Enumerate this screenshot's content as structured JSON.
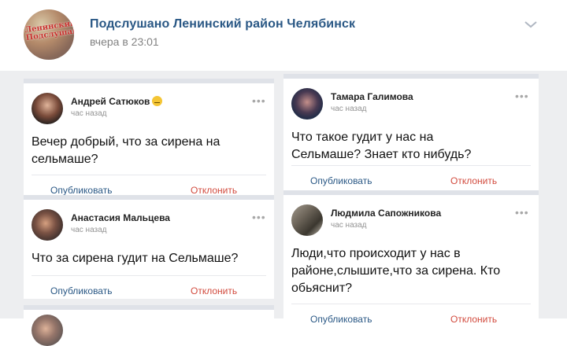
{
  "group": {
    "name": "Подслушано Ленинский район Челябинск",
    "time": "вчера в 23:01",
    "logo_text": "Ленинский Подслушано"
  },
  "actions": {
    "publish": "Опубликовать",
    "reject": "Отклонить"
  },
  "more": "•••",
  "posts": [
    {
      "author": "Андрей Сатюков",
      "time": "час назад",
      "text_lines": [
        "Вечер добрый, что за сирена на",
        "сельмаше?"
      ]
    },
    {
      "author": "Тамара Галимова",
      "time": "час назад",
      "text_lines": [
        "Что такое гудит у нас на",
        "Сельмаше? Знает кто нибудь?"
      ]
    },
    {
      "author": "Анастасия Мальцева",
      "time": "час назад",
      "text_lines": [
        "Что за сирена гудит на Сельмаше?"
      ]
    },
    {
      "author": "Людмила Сапожникова",
      "time": "час назад",
      "text_lines": [
        "Люди,что происходит у нас в",
        "районе,слышите,что за сирена. Кто",
        "обьяснит?"
      ]
    }
  ],
  "colors": {
    "link": "#2a5885",
    "reject": "#d24b3e",
    "feed_bg": "#edeef0"
  }
}
